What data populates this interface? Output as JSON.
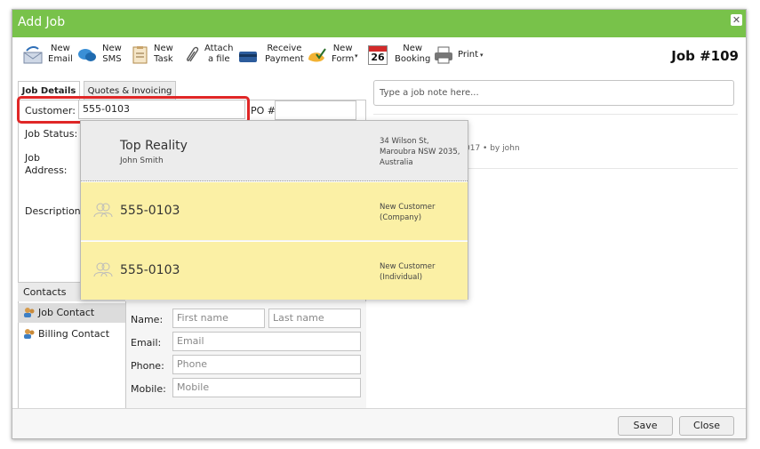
{
  "window": {
    "title": "Add Job"
  },
  "toolbar": {
    "new_email": "New\nEmail",
    "new_sms": "New\nSMS",
    "new_task": "New\nTask",
    "attach": "Attach\na file",
    "receive": "Receive\nPayment",
    "new_form": "New\nForm",
    "new_booking": "New\nBooking",
    "calendar_day": "26",
    "print": "Print"
  },
  "job_number": "Job #109",
  "tabs": [
    "Job Details",
    "Quotes & Invoicing"
  ],
  "form": {
    "customer_label": "Customer:",
    "customer_value": "555-0103",
    "po_label": "PO #",
    "job_status_label": "Job Status:",
    "job_address_label": "Job\nAddress:",
    "description_label": "Description:"
  },
  "note_placeholder": "Type a job note here...",
  "activity_text": "017 •  by john",
  "dropdown": [
    {
      "name": "Top Reality",
      "sub": "John Smith",
      "right": "34 Wilson St,\nMaroubra NSW 2035,\nAustralia"
    },
    {
      "name": "555-0103",
      "right": "New Customer\n(Company)"
    },
    {
      "name": "555-0103",
      "right": "New Customer\n(Individual)"
    }
  ],
  "contacts": {
    "header": "Contacts",
    "items": [
      "Job Contact",
      "Billing Contact"
    ],
    "name_label": "Name:",
    "first_placeholder": "First name",
    "last_placeholder": "Last name",
    "email_label": "Email:",
    "email_placeholder": "Email",
    "phone_label": "Phone:",
    "phone_placeholder": "Phone",
    "mobile_label": "Mobile:",
    "mobile_placeholder": "Mobile"
  },
  "footer": {
    "save": "Save",
    "close": "Close"
  },
  "colors": {
    "titlebar": "#78c24a",
    "highlight": "#e02727",
    "suggestion": "#fbf0a5"
  }
}
